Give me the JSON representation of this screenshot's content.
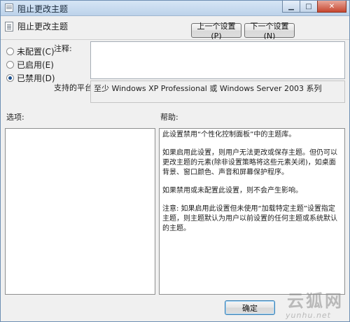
{
  "window": {
    "title": "阻止更改主题"
  },
  "header": {
    "policy_title": "阻止更改主题",
    "prev_button": "上一个设置(P)",
    "next_button": "下一个设置(N)"
  },
  "state_options": [
    {
      "label": "未配置(C)",
      "checked": false
    },
    {
      "label": "已启用(E)",
      "checked": false
    },
    {
      "label": "已禁用(D)",
      "checked": true
    }
  ],
  "comment": {
    "label": "注释:",
    "value": ""
  },
  "platform": {
    "label": "支持的平台:",
    "value": "至少 Windows XP Professional 或 Windows Server 2003 系列"
  },
  "options_label": "选项:",
  "help": {
    "label": "帮助:",
    "paragraphs": [
      "此设置禁用“个性化控制面板”中的主题库。",
      "如果启用此设置，则用户无法更改或保存主题。但仍可以更改主题的元素(除非设置策略将这些元素关闭)，如桌面背景、窗口颜色、声音和屏幕保护程序。",
      "如果禁用或未配置此设置，则不会产生影响。",
      "注意: 如果启用此设置但未使用“加载特定主题”设置指定主题，则主题默认为用户以前设置的任何主题或系统默认的主题。"
    ]
  },
  "footer": {
    "ok_button": "确定"
  },
  "watermark": {
    "text": "云狐网",
    "sub": "yunhu.net"
  }
}
